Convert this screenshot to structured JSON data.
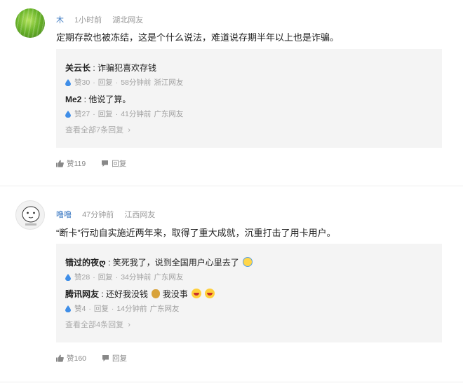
{
  "comments": [
    {
      "user": "木",
      "time": "1小时前",
      "location": "湖北网友",
      "text": "定期存款也被冻结，这是个什么说法，难道说存期半年以上也是诈骗。",
      "replies": [
        {
          "user": "关云长",
          "text": "诈骗犯喜欢存钱",
          "likes": "赞30",
          "reply_label": "回复",
          "time": "58分钟前",
          "location": "浙江网友"
        },
        {
          "user": "Me2",
          "text": "他说了算。",
          "likes": "赞27",
          "reply_label": "回复",
          "time": "41分钟前",
          "location": "广东网友"
        }
      ],
      "view_all": "查看全部7条回复",
      "likes": "赞119",
      "reply_label": "回复"
    },
    {
      "user": "噜噜",
      "time": "47分钟前",
      "location": "江西网友",
      "text": "“断卡”行动自实施近两年来，取得了重大成就，沉重打击了用卡用户。",
      "replies": [
        {
          "user": "错过的夜ღ",
          "text": "笑死我了，说到全国用户心里去了",
          "likes": "赞28",
          "reply_label": "回复",
          "time": "34分钟前",
          "location": "广东网友"
        },
        {
          "user": "腾讯网友",
          "text": "还好我没钱",
          "text2": "我没事",
          "likes": "赞4",
          "reply_label": "回复",
          "time": "14分钟前",
          "location": "广东网友"
        }
      ],
      "view_all": "查看全部4条回复",
      "likes": "赞160",
      "reply_label": "回复"
    }
  ],
  "colors": {
    "username": "#3a78c2",
    "drop_icon": "#3f8ee8",
    "reply_bg": "#f4f4f4"
  }
}
